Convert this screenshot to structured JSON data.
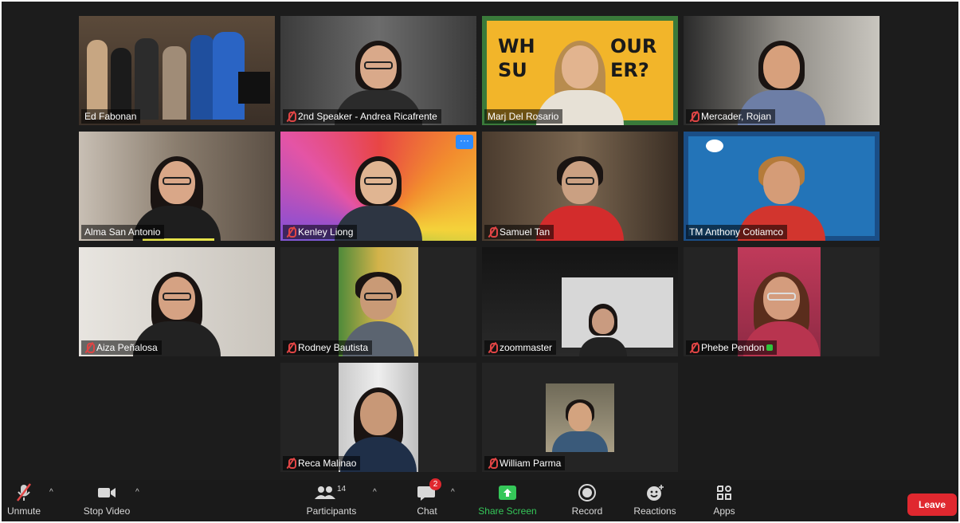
{
  "participants": [
    {
      "name": "Ed Fabonan",
      "muted": false
    },
    {
      "name": "2nd Speaker - Andrea Ricafrente",
      "muted": true
    },
    {
      "name": "Marj Del Rosario",
      "muted": false
    },
    {
      "name": "Mercader, Rojan",
      "muted": true
    },
    {
      "name": "Alma San Antonio",
      "muted": false
    },
    {
      "name": "Kenley Liong",
      "muted": true
    },
    {
      "name": "Samuel Tan",
      "muted": true
    },
    {
      "name": "TM Anthony Cotiamco",
      "muted": false
    },
    {
      "name": "Aiza Peñalosa",
      "muted": true
    },
    {
      "name": "Rodney Bautista",
      "muted": true
    },
    {
      "name": "zoommaster",
      "muted": true
    },
    {
      "name": "Phebe Pendon",
      "muted": true
    },
    {
      "name": "Reca Malinao",
      "muted": true
    },
    {
      "name": "William Parma",
      "muted": true
    }
  ],
  "background_text": {
    "line1": "WH",
    "line2": "OUR",
    "line3": "SU",
    "line4": "ER?"
  },
  "toolbar": {
    "unmute": "Unmute",
    "stop_video": "Stop Video",
    "participants": "Participants",
    "participant_count": "14",
    "chat": "Chat",
    "chat_badge": "2",
    "share_screen": "Share Screen",
    "record": "Record",
    "reactions": "Reactions",
    "apps": "Apps",
    "leave": "Leave"
  },
  "colors": {
    "active_speaker": "#e6e34a",
    "share_green": "#35c759",
    "leave_red": "#e0282f",
    "muted_red": "#e04545"
  }
}
